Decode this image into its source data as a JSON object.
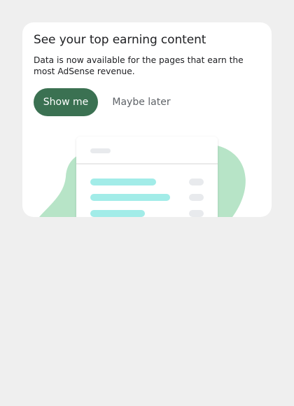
{
  "promo": {
    "title": "See your top earning content",
    "description": "Data is now available for the pages that earn the most AdSense revenue.",
    "primary_label": "Show me",
    "secondary_label": "Maybe later"
  },
  "colors": {
    "page_background": "#efefef",
    "card_background": "#ffffff",
    "primary_button": "#3b7152",
    "blob": "#b7e4c7",
    "bar_highlight": "#a2ece8",
    "bar_muted": "#e8eaed"
  },
  "illustration": {
    "icon": "report-table-illustration"
  }
}
